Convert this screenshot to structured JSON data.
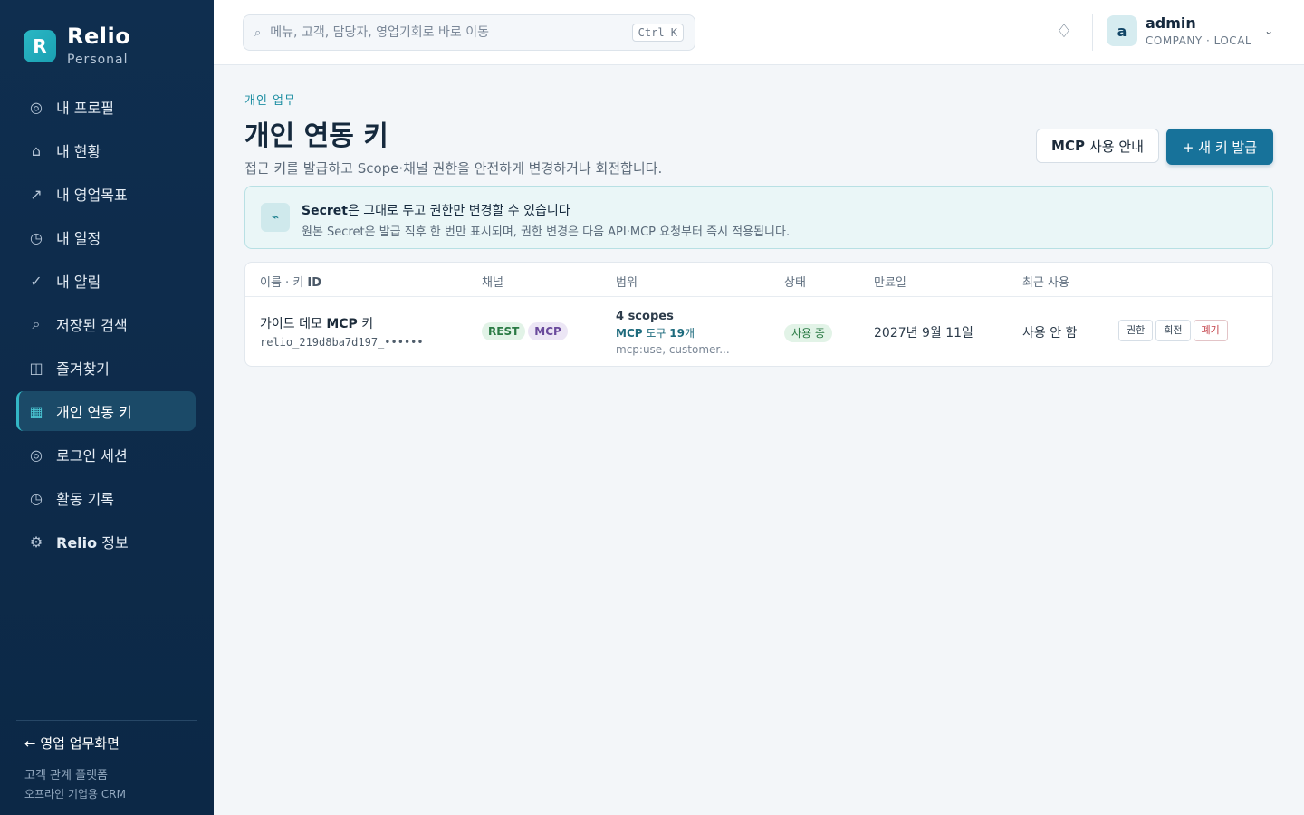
{
  "brand": {
    "logo_letter": "R",
    "name": "Relio",
    "subtitle": "Personal"
  },
  "sidebar": {
    "items": [
      {
        "icon": "◎",
        "icon_name": "profile-icon",
        "label": "내 프로필"
      },
      {
        "icon": "⌂",
        "icon_name": "home-icon",
        "label": "내 현황"
      },
      {
        "icon": "↗",
        "icon_name": "trend-icon",
        "label": "내 영업목표"
      },
      {
        "icon": "◷",
        "icon_name": "clock-icon",
        "label": "내 일정"
      },
      {
        "icon": "✓",
        "icon_name": "check-icon",
        "label": "내 알림"
      },
      {
        "icon": "⌕",
        "icon_name": "search-icon",
        "label": "저장된 검색"
      },
      {
        "icon": "◫",
        "icon_name": "bookmark-icon",
        "label": "즐겨찾기"
      },
      {
        "icon": "▦",
        "icon_name": "key-grid-icon",
        "label": "개인 연동 키",
        "active": true
      },
      {
        "icon": "◎",
        "icon_name": "session-icon",
        "label": "로그인 세션"
      },
      {
        "icon": "◷",
        "icon_name": "history-icon",
        "label": "활동 기록"
      },
      {
        "icon": "⚙",
        "icon_name": "gear-icon",
        "label_bold": "Relio",
        "label_rest": " 정보"
      }
    ],
    "back_link": "← 영업 업무화면",
    "footer_line1": "고객 관계 플랫폼",
    "footer_line2": "오프라인 기업용 CRM"
  },
  "topbar": {
    "search_icon": "⌕",
    "search_placeholder": "메뉴, 고객, 담당자, 영업기회로 바로 이동",
    "shortcut": "Ctrl K",
    "notification_icon": "♢",
    "user": {
      "avatar_letter": "a",
      "name": "admin",
      "org": "COMPANY · LOCAL",
      "caret": "⌄"
    }
  },
  "page": {
    "breadcrumb": "개인 업무",
    "title": "개인 연동 키",
    "description": "접근 키를 발급하고 Scope·채널 권한을 안전하게 변경하거나 회전합니다.",
    "guide_button_bold": "MCP",
    "guide_button_rest": "사용 안내",
    "new_key_button": "+ 새 키 발급"
  },
  "notice": {
    "icon": "⌁",
    "title_bold": "Secret",
    "title_rest": "은 그대로 두고 권한만 변경할 수 있습니다",
    "description": "원본 Secret은 발급 직후 한 번만 표시되며, 권한 변경은 다음 API·MCP 요청부터 즉시 적용됩니다."
  },
  "table": {
    "headers": {
      "name_prefix": "이름 · 키 ",
      "name_bold": "ID",
      "channel": "채널",
      "scope": "범위",
      "status": "상태",
      "expiry": "만료일",
      "last_used": "최근 사용"
    },
    "rows": [
      {
        "name_prefix": "가이드 데모 ",
        "name_bold": "MCP",
        "name_suffix": " 키",
        "key_id": "relio_219d8ba7d197_••••••",
        "channels": [
          "REST",
          "MCP"
        ],
        "scope_count": "4 scopes",
        "scope_tool_bold": "MCP",
        "scope_tool_mid": " 도구 ",
        "scope_tool_num": "19",
        "scope_tool_unit": "개",
        "scope_list": "mcp:use, customer...",
        "status": "사용 중",
        "expiry": "2027년 9월 11일",
        "last_used": "사용 안 함",
        "actions": {
          "permission": "권한",
          "rotate": "회전",
          "revoke": "폐기"
        }
      }
    ]
  },
  "colors": {
    "sidebar_bg": "#0f2e4f",
    "accent": "#17729a",
    "brand_teal": "#2bb7c4",
    "success_text": "#2a7a44",
    "danger_text": "#c4424a"
  }
}
